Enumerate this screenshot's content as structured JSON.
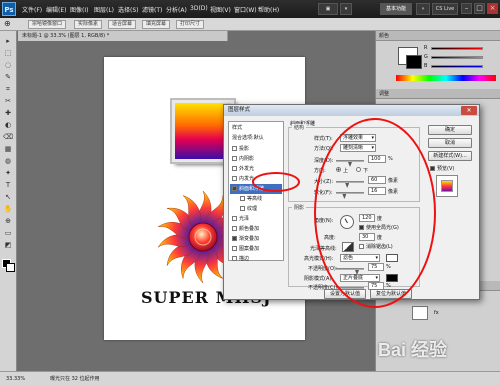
{
  "app": {
    "logo": "Ps",
    "menu": [
      "文件(F)",
      "编辑(E)",
      "图像(I)",
      "图层(L)",
      "选择(S)",
      "滤镜(T)",
      "分析(A)",
      "3D(D)",
      "视图(V)",
      "窗口(W)",
      "帮助(H)"
    ],
    "workspace": "基本功能",
    "cs_live": "CS Live"
  },
  "options_bar": {
    "tolerance_label": "宗哈镜像窗口",
    "b1": "实际像素",
    "b2": "适合屏幕",
    "b3": "填充屏幕",
    "b4": "打印尺寸"
  },
  "document": {
    "tab": "未标题-1 @ 33.3% (图层 1, RGB/8) *",
    "logo_text": "SUPER MHSJ"
  },
  "status": {
    "zoom": "33.33%",
    "info": "曝光只在 32 位起作用"
  },
  "dialog": {
    "title": "图层样式",
    "close": "✕",
    "styles_header": "样式",
    "blend_header": "混合选项:默认",
    "items": [
      {
        "label": "投影",
        "checked": false
      },
      {
        "label": "内阴影",
        "checked": false
      },
      {
        "label": "外发光",
        "checked": false
      },
      {
        "label": "内发光",
        "checked": false
      },
      {
        "label": "斜面和浮雕",
        "checked": true,
        "selected": true
      },
      {
        "label": "等高线",
        "checked": false,
        "sub": true
      },
      {
        "label": "纹理",
        "checked": false,
        "sub": true
      },
      {
        "label": "光泽",
        "checked": false
      },
      {
        "label": "颜色叠加",
        "checked": false
      },
      {
        "label": "渐变叠加",
        "checked": true
      },
      {
        "label": "图案叠加",
        "checked": false
      },
      {
        "label": "描边",
        "checked": false
      }
    ],
    "section_title": "斜面和浮雕",
    "structure": {
      "title": "结构",
      "style_label": "样式(T):",
      "style_value": "浮雕效果",
      "technique_label": "方法(Q):",
      "technique_value": "雕刻清晰",
      "depth_label": "深度(D):",
      "depth_value": "100",
      "depth_unit": "%",
      "depth_level": 0.5,
      "direction_label": "方向:",
      "dir_up": "上",
      "dir_down": "下",
      "size_label": "大小(Z):",
      "size_value": "60",
      "size_unit": "像素",
      "size_level": 0.4,
      "soften_label": "软化(F):",
      "soften_value": "16",
      "soften_unit": "像素",
      "soften_level": 0.3
    },
    "shading": {
      "title": "阴影",
      "angle_label": "角度(N):",
      "angle_value": "120",
      "angle_unit": "度",
      "global_light": "使用全局光(G)",
      "altitude_label": "高度:",
      "altitude_value": "30",
      "altitude_unit": "度",
      "gloss_label": "光泽等高线:",
      "antialias": "消除锯齿(L)",
      "highlight_label": "高光模式(H):",
      "highlight_value": "滤色",
      "highlight_color": "#ffffff",
      "hl_opacity_label": "不透明度(O):",
      "hl_opacity_value": "75",
      "hl_opacity_level": 0.75,
      "shadow_label": "阴影模式(A):",
      "shadow_value": "正片叠底",
      "shadow_color": "#000000",
      "sh_opacity_label": "不透明度(C):",
      "sh_opacity_value": "75",
      "sh_opacity_level": 0.75,
      "percent": "%"
    },
    "btn_default": "设置为默认值",
    "btn_reset": "复位为默认值",
    "btn_ok": "确定",
    "btn_cancel": "取消",
    "btn_new_style": "新建样式(W)...",
    "preview_label": "预览(V)"
  },
  "right_panel": {
    "colors_tab": "颜色",
    "adjust_tab": "调整",
    "layers_tab": "图层",
    "channel_r": "R",
    "channel_g": "G",
    "channel_b": "B",
    "layer_fx": "fx"
  },
  "watermark": "Bai 经验",
  "colors": {
    "selection_blue": "#3d6fc2",
    "annotation_red": "#e11111",
    "gradient": [
      "#ffe300",
      "#ff6a00",
      "#e5004f",
      "#3b0ea8"
    ]
  }
}
